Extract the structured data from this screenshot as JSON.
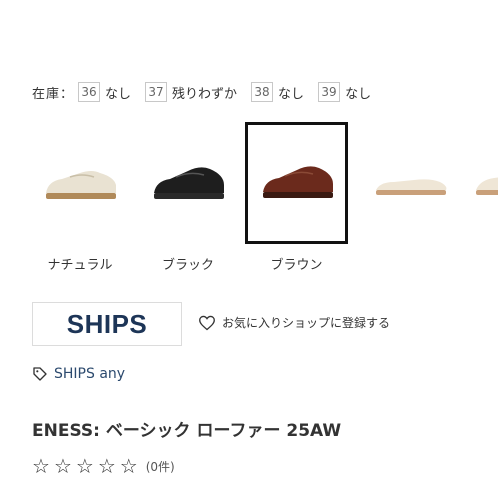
{
  "stock": {
    "label": "在庫：",
    "items": [
      {
        "size": "36",
        "status": "なし"
      },
      {
        "size": "37",
        "status": "残りわずか"
      },
      {
        "size": "38",
        "status": "なし"
      },
      {
        "size": "39",
        "status": "なし"
      }
    ]
  },
  "colors": [
    {
      "label": "ナチュラル",
      "shoe_color": "#e9e2d2",
      "sole_color": "#b08a5a",
      "selected": false
    },
    {
      "label": "ブラック",
      "shoe_color": "#1e1e1e",
      "sole_color": "#2a2a2a",
      "selected": false
    },
    {
      "label": "ブラウン",
      "shoe_color": "#6b2a1c",
      "sole_color": "#3a1a12",
      "selected": true
    },
    {
      "label": "",
      "shoe_color": "#efe6d6",
      "sole_color": "#c9a07a",
      "selected": false
    },
    {
      "label": "",
      "shoe_color": "#efe6d6",
      "sole_color": "#c9a07a",
      "selected": false
    }
  ],
  "brand": {
    "logo_text": "SHIPS",
    "favorite_label": "お気に入りショップに登録する",
    "link_text": "SHIPS any"
  },
  "product": {
    "title": "ENESS: ベーシック ローファー 25AW",
    "rating_stars": 0,
    "review_count": "(0件)"
  },
  "icons": {
    "heart": "heart-icon",
    "tag": "tag-icon",
    "star": "star-outline-icon"
  }
}
